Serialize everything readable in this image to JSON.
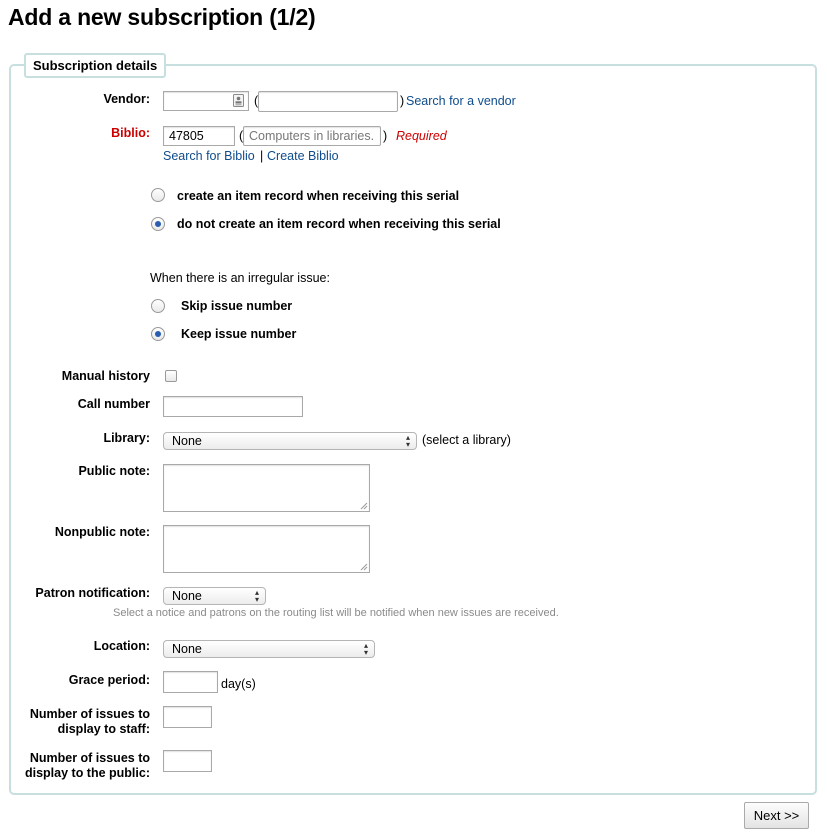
{
  "page": {
    "title": "Add a new subscription (1/2)"
  },
  "section": {
    "legend": "Subscription details"
  },
  "vendor": {
    "label": "Vendor:",
    "id_value": "",
    "name_value": "",
    "open_paren": "(",
    "close_paren": ")",
    "search_link": "Search for a vendor",
    "icon": "contact-card-icon"
  },
  "biblio": {
    "label": "Biblio:",
    "id_value": "47805",
    "title_value": "Computers in libraries.",
    "open_paren": "(",
    "close_paren": ")",
    "required": "Required",
    "search_link": "Search for Biblio",
    "separator": "|",
    "create_link": "Create Biblio"
  },
  "item_record": {
    "options": [
      {
        "label": "create an item record when receiving this serial",
        "selected": false
      },
      {
        "label": "do not create an item record when receiving this serial",
        "selected": true
      }
    ]
  },
  "irregular": {
    "prompt": "When there is an irregular issue:",
    "options": [
      {
        "label": "Skip issue number",
        "selected": false
      },
      {
        "label": "Keep issue number",
        "selected": true
      }
    ]
  },
  "manual_history": {
    "label": "Manual history",
    "checked": false
  },
  "call_number": {
    "label": "Call number",
    "value": ""
  },
  "library": {
    "label": "Library:",
    "selected": "None",
    "hint": "(select a library)"
  },
  "public_note": {
    "label": "Public note:",
    "value": ""
  },
  "nonpublic_note": {
    "label": "Nonpublic note:",
    "value": ""
  },
  "patron_notification": {
    "label": "Patron notification:",
    "selected": "None",
    "hint": "Select a notice and patrons on the routing list will be notified when new issues are received."
  },
  "location": {
    "label": "Location:",
    "selected": "None"
  },
  "grace_period": {
    "label": "Grace period:",
    "value": "",
    "unit": "day(s)"
  },
  "issues_staff": {
    "label_line1": "Number of issues to",
    "label_line2": "display to staff:",
    "value": ""
  },
  "issues_public": {
    "label_line1": "Number of issues to",
    "label_line2": "display to the public:",
    "value": ""
  },
  "next_button": {
    "label": "Next >>"
  },
  "colors": {
    "link": "#0f4c8c",
    "required": "#cc0000",
    "panel_border": "#c8dfe0",
    "radio_selected": "#2a5db0"
  }
}
